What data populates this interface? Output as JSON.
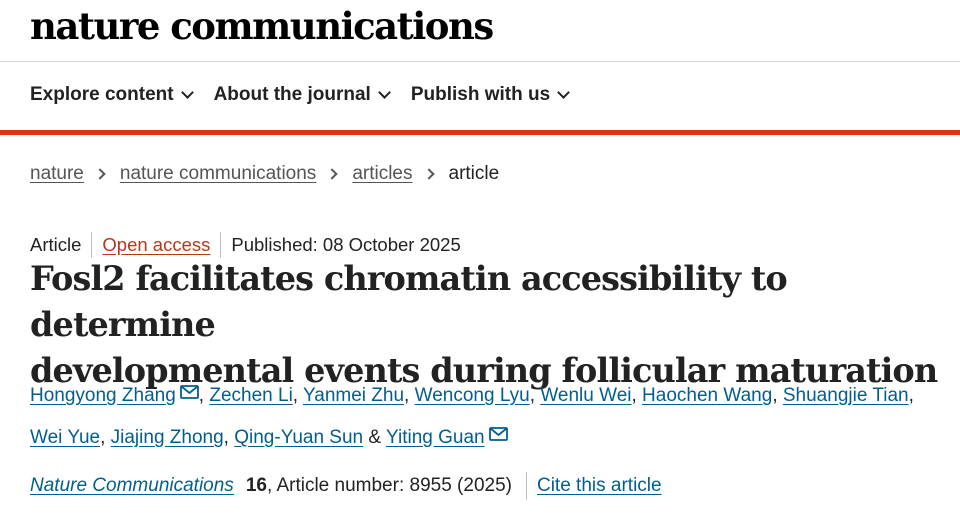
{
  "brand": "nature communications",
  "nav": [
    {
      "label": "Explore content"
    },
    {
      "label": "About the journal"
    },
    {
      "label": "Publish with us"
    }
  ],
  "breadcrumb": {
    "items": [
      "nature",
      "nature communications",
      "articles"
    ],
    "current": "article"
  },
  "meta": {
    "type": "Article",
    "access": "Open access",
    "published": "Published: 08 October 2025"
  },
  "title_lines": [
    "Fosl2 facilitates chromatin accessibility to determine",
    "developmental events during follicular maturation"
  ],
  "authors": [
    "Hongyong Zhang",
    "Zechen Li",
    "Yanmei Zhu",
    "Wencong Lyu",
    "Wenlu Wei",
    "Haochen Wang",
    "Shuangjie Tian",
    "Wei Yue",
    "Jiajing Zhong",
    "Qing-Yuan Sun",
    "Yiting Guan"
  ],
  "author_separator": ",",
  "author_last_separator": "&",
  "citation": {
    "journal": "Nature Communications",
    "volume": "16",
    "article_number": ", Article number: 8955 (2025)",
    "cite_label": "Cite this article"
  },
  "icons": {
    "nav_chevron": "chevron-down-icon",
    "breadcrumb_separator": "chevron-right-icon",
    "corresponding_author": "mail-icon"
  },
  "colors": {
    "accent_red": "#e0301e",
    "link_blue": "#025e8d",
    "open_access": "#b6381b"
  }
}
